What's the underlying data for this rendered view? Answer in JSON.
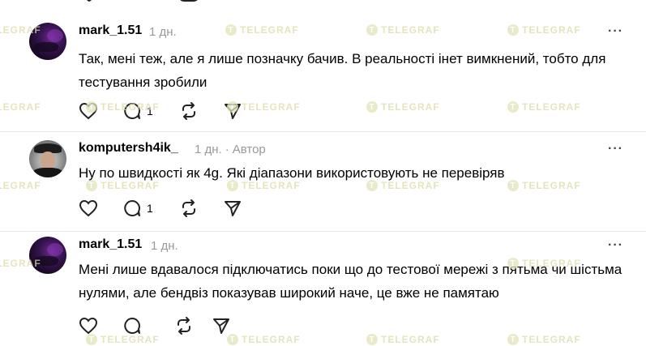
{
  "watermark": {
    "text": "TELEGRAF",
    "logo": "T"
  },
  "posts": [
    {
      "username": "mark_1.51",
      "time": "1 дн.",
      "author_tag": "",
      "text": "Так, мені теж, але я лише позначку бачив. В реальності інет вимкнений, тобто для тестування зробили",
      "like_count": "",
      "reply_count": "1"
    },
    {
      "username": "komputersh4ik_",
      "time": "1 дн.",
      "author_tag": "Автор",
      "separator": "·",
      "text": "Ну по швидкості як 4g. Які діапазони використовують не перевіряв",
      "like_count": "",
      "reply_count": "1"
    },
    {
      "username": "mark_1.51",
      "time": "1 дн.",
      "author_tag": "",
      "text": "Мені лише вдавалося підключатись поки що до тестової мережі з пятьма чи шістьма нулями, але бендвіз показував широкий наче, це вже не памятаю",
      "like_count": "",
      "reply_count": ""
    }
  ],
  "more_label": "···",
  "icons": {
    "like": "heart-icon",
    "reply": "comment-icon",
    "repost": "repost-icon",
    "share": "send-icon",
    "more": "more-dots-icon"
  },
  "colors": {
    "text": "#000000",
    "meta": "#999999",
    "divider": "#e6e6e6",
    "watermark": "#dcdcaa"
  }
}
